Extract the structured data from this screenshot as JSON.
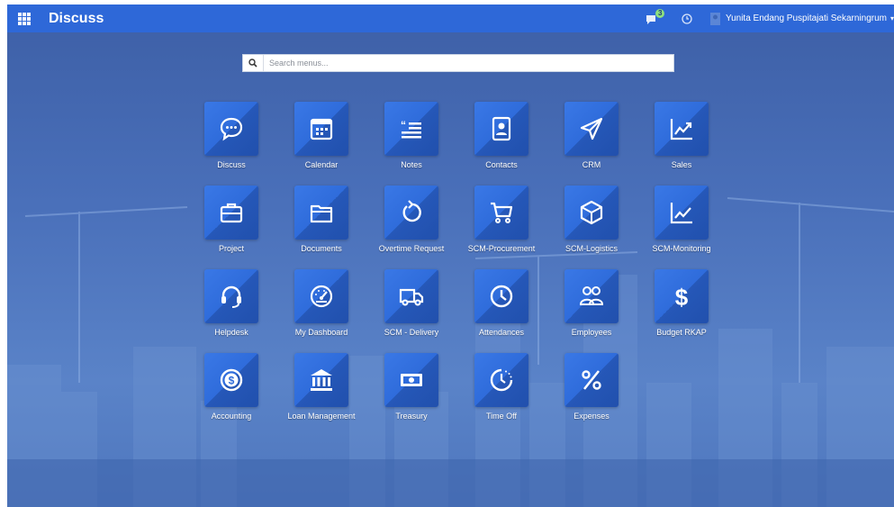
{
  "topbar": {
    "title": "Discuss",
    "chat_count": "3",
    "user_name": "Yunita Endang Puspitajati Sekarningrum",
    "caret": "▾"
  },
  "search": {
    "placeholder": "Search menus..."
  },
  "apps": [
    {
      "label": "Discuss",
      "icon": "chat-bubble-icon"
    },
    {
      "label": "Calendar",
      "icon": "calendar-icon"
    },
    {
      "label": "Notes",
      "icon": "notes-icon"
    },
    {
      "label": "Contacts",
      "icon": "contact-card-icon"
    },
    {
      "label": "CRM",
      "icon": "paper-plane-icon"
    },
    {
      "label": "Sales",
      "icon": "trend-chart-icon"
    },
    {
      "label": "Project",
      "icon": "briefcase-icon"
    },
    {
      "label": "Documents",
      "icon": "folder-icon"
    },
    {
      "label": "Overtime Request",
      "icon": "refresh-icon"
    },
    {
      "label": "SCM-Procurement",
      "icon": "cart-icon"
    },
    {
      "label": "SCM-Logistics",
      "icon": "cube-icon"
    },
    {
      "label": "SCM-Monitoring",
      "icon": "line-chart-icon"
    },
    {
      "label": "Helpdesk",
      "icon": "headset-icon"
    },
    {
      "label": "My Dashboard",
      "icon": "gauge-icon"
    },
    {
      "label": "SCM - Delivery",
      "icon": "truck-icon"
    },
    {
      "label": "Attendances",
      "icon": "clock-icon"
    },
    {
      "label": "Employees",
      "icon": "people-icon"
    },
    {
      "label": "Budget RKAP",
      "icon": "dollar-icon"
    },
    {
      "label": "Accounting",
      "icon": "coin-icon"
    },
    {
      "label": "Loan Management",
      "icon": "bank-icon"
    },
    {
      "label": "Treasury",
      "icon": "banknote-icon"
    },
    {
      "label": "Time Off",
      "icon": "timer-icon"
    },
    {
      "label": "Expenses",
      "icon": "percent-icon"
    }
  ]
}
